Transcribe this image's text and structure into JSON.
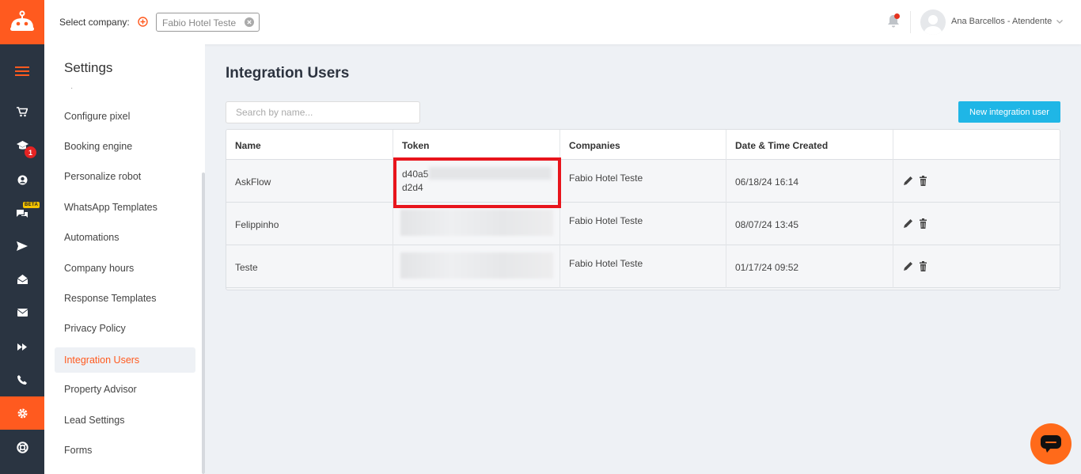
{
  "colors": {
    "brand": "#ff5a1f",
    "rail": "#2a3441",
    "accent_button": "#1fb6e6",
    "highlight": "#e8141c"
  },
  "topbar": {
    "select_label": "Select company:",
    "company_chip": "Fabio Hotel Teste",
    "user_name": "Ana Barcellos - Atendente"
  },
  "rail": {
    "icons": [
      "menu-icon",
      "cart-icon",
      "graduation-cap-icon",
      "user-circle-icon",
      "chat-icon",
      "send-icon",
      "mail-open-icon",
      "envelope-icon",
      "fast-forward-icon",
      "phone-icon",
      "gear-icon",
      "lifebuoy-icon"
    ],
    "badge_count": "1",
    "beta_label": "BETA"
  },
  "settings": {
    "title": "Settings",
    "items": [
      {
        "label": "Configure pixel"
      },
      {
        "label": "Booking engine"
      },
      {
        "label": "Personalize robot"
      },
      {
        "label": "WhatsApp Templates"
      },
      {
        "label": "Automations"
      },
      {
        "label": "Company hours"
      },
      {
        "label": "Response Templates"
      },
      {
        "label": "Privacy Policy"
      },
      {
        "label": "Integration Users",
        "active": true
      },
      {
        "label": "Property Advisor"
      },
      {
        "label": "Lead Settings"
      },
      {
        "label": "Forms"
      }
    ]
  },
  "main": {
    "title": "Integration Users",
    "search_placeholder": "Search by name...",
    "new_button": "New integration user",
    "table": {
      "headers": [
        "Name",
        "Token",
        "Companies",
        "Date & Time Created",
        ""
      ],
      "rows": [
        {
          "name": "AskFlow",
          "token_line1": "d40a5",
          "token_line2": "d2d4",
          "company": "Fabio Hotel Teste",
          "created": "06/18/24 16:14"
        },
        {
          "name": "Felippinho",
          "company": "Fabio Hotel Teste",
          "created": "08/07/24 13:45"
        },
        {
          "name": "Teste",
          "company": "Fabio Hotel Teste",
          "created": "01/17/24 09:52"
        }
      ]
    }
  }
}
